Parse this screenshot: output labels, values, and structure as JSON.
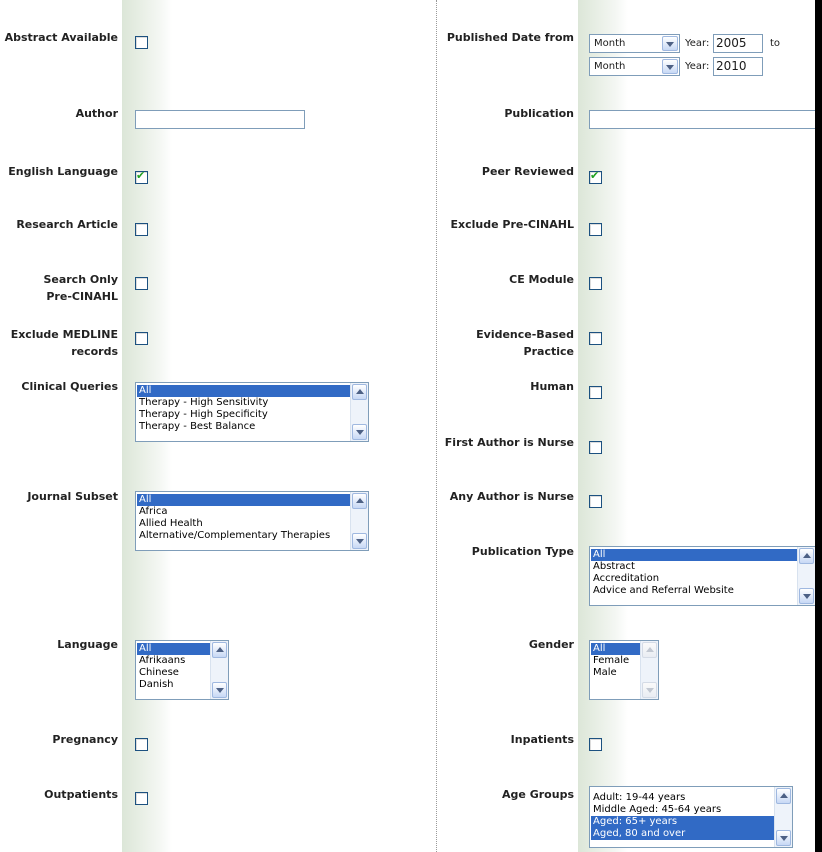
{
  "left": {
    "abstract_available": {
      "label": "Abstract Available",
      "checked": false
    },
    "author": {
      "label": "Author",
      "value": ""
    },
    "english_language": {
      "label": "English Language",
      "checked": true
    },
    "research_article": {
      "label": "Research Article",
      "checked": false
    },
    "search_only_pre_cinahl": {
      "label_1": "Search Only",
      "label_2": "Pre-CINAHL",
      "checked": false
    },
    "exclude_medline": {
      "label_1": "Exclude MEDLINE",
      "label_2": "records",
      "checked": false
    },
    "clinical_queries": {
      "label": "Clinical Queries",
      "options": [
        "All",
        "Therapy - High Sensitivity",
        "Therapy - High Specificity",
        "Therapy - Best Balance"
      ],
      "selected": "All"
    },
    "journal_subset": {
      "label": "Journal Subset",
      "options": [
        "All",
        "Africa",
        "Allied Health",
        "Alternative/Complementary Therapies"
      ],
      "selected": "All"
    },
    "language": {
      "label": "Language",
      "options": [
        "All",
        "Afrikaans",
        "Chinese",
        "Danish"
      ],
      "selected": "All"
    },
    "pregnancy": {
      "label": "Pregnancy",
      "checked": false
    },
    "outpatients": {
      "label": "Outpatients",
      "checked": false
    }
  },
  "right": {
    "published_date": {
      "label": "Published Date from",
      "month_from": "Month",
      "year_label": "Year:",
      "year_from": "2005",
      "to_label": "to",
      "month_to": "Month",
      "year_to": "2010"
    },
    "publication": {
      "label": "Publication",
      "value": ""
    },
    "peer_reviewed": {
      "label": "Peer Reviewed",
      "checked": true
    },
    "exclude_pre_cinahl": {
      "label": "Exclude Pre-CINAHL",
      "checked": false
    },
    "ce_module": {
      "label": "CE Module",
      "checked": false
    },
    "evidence_based_practice": {
      "label_1": "Evidence-Based",
      "label_2": "Practice",
      "checked": false
    },
    "human": {
      "label": "Human",
      "checked": false
    },
    "first_author_nurse": {
      "label": "First Author is Nurse",
      "checked": false
    },
    "any_author_nurse": {
      "label": "Any Author is Nurse",
      "checked": false
    },
    "publication_type": {
      "label": "Publication Type",
      "options": [
        "All",
        "Abstract",
        "Accreditation",
        "Advice and Referral Website"
      ],
      "selected": "All"
    },
    "gender": {
      "label": "Gender",
      "options": [
        "All",
        "Female",
        "Male"
      ],
      "selected": "All"
    },
    "inpatients": {
      "label": "Inpatients",
      "checked": false
    },
    "age_groups": {
      "label": "Age Groups",
      "options": [
        "Adult: 19-44 years",
        "Middle Aged: 45-64 years",
        "Aged: 65+ years",
        "Aged, 80 and over"
      ],
      "selected": [
        "Aged: 65+ years",
        "Aged, 80 and over"
      ]
    }
  }
}
